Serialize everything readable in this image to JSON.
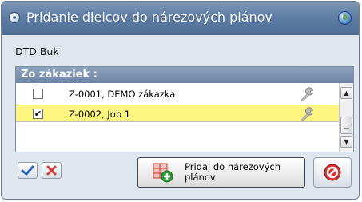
{
  "window": {
    "title": "Pridanie dielcov do nárezových plánov"
  },
  "material_label": "DTD Buk",
  "orders_panel": {
    "header": "Zo zákaziek :",
    "rows": [
      {
        "text": "Z-0001, DEMO zákazka",
        "checked": false,
        "check_mark": ""
      },
      {
        "text": "Z-0002, Job 1",
        "checked": true,
        "check_mark": "✔"
      }
    ],
    "selected_row_color": "#fdf57f"
  },
  "buttons": {
    "add_to_plans_label": "Pridaj do nárezových plánov"
  },
  "icons": {
    "title": "app-icon",
    "title_right": "globe-icon",
    "row_action": "wrench-icon",
    "select_all": "checkmark-icon",
    "deselect_all": "x-icon",
    "add_to_plans": "cutting-plan-add-icon",
    "close": "stop-icon"
  }
}
